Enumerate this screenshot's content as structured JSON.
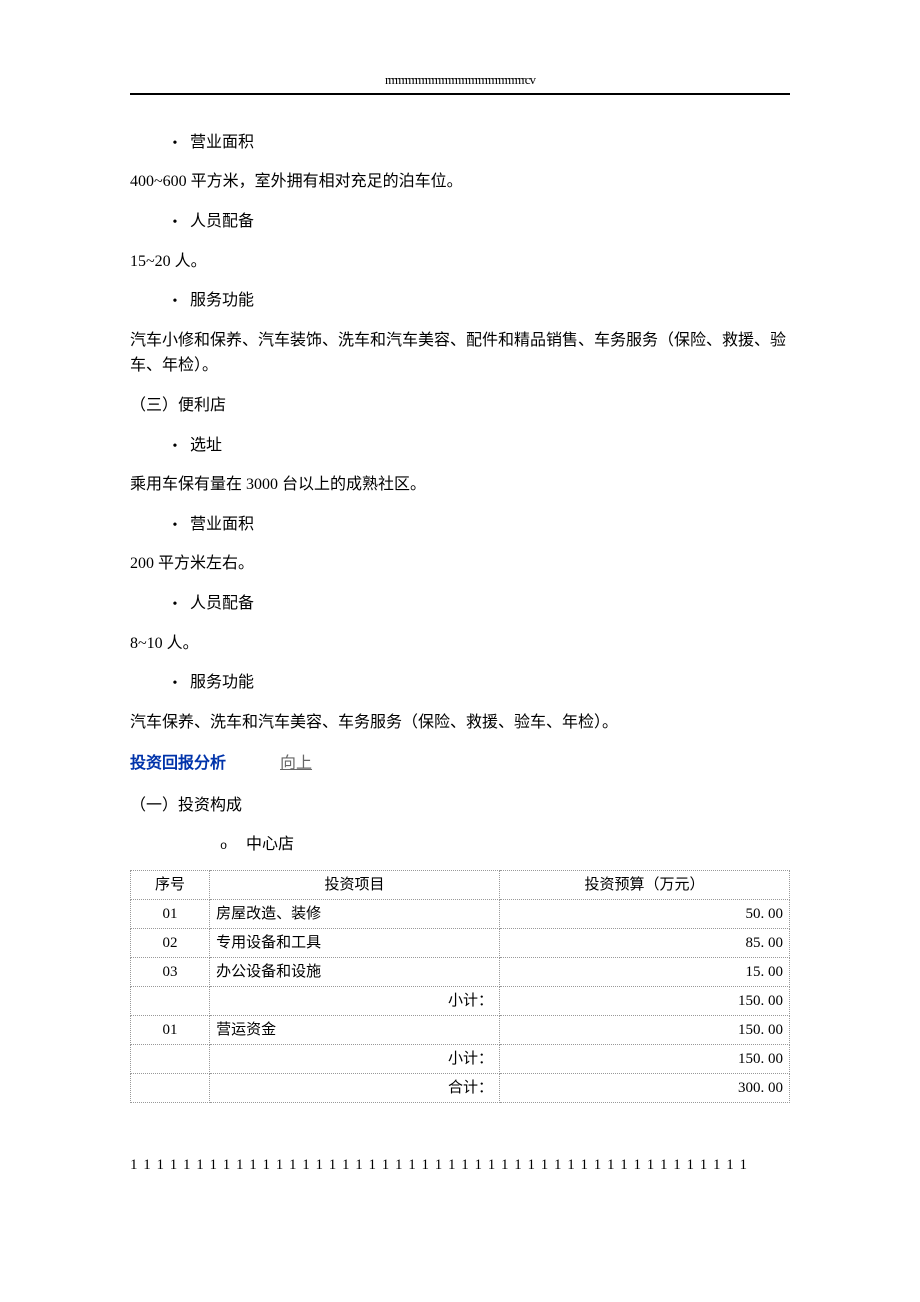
{
  "header": "rrrrrrrrrrrrrrrrrrrrrrrrrrrrrrrrrrrrrrrrrrcv",
  "section1": {
    "area_label": "营业面积",
    "area_text": "400~600 平方米，室外拥有相对充足的泊车位。",
    "staff_label": "人员配备",
    "staff_text": "15~20 人。",
    "service_label": "服务功能",
    "service_text": "汽车小修和保养、汽车装饰、洗车和汽车美容、配件和精品销售、车务服务（保险、救援、验车、年检）。"
  },
  "section2": {
    "title": "（三）便利店",
    "site_label": "选址",
    "site_text": "乘用车保有量在 3000 台以上的成熟社区。",
    "area_label": "营业面积",
    "area_text": "200 平方米左右。",
    "staff_label": "人员配备",
    "staff_text": "8~10 人。",
    "service_label": "服务功能",
    "service_text": "汽车保养、洗车和汽车美容、车务服务（保险、救援、验车、年检）。"
  },
  "analysis": {
    "title": "投资回报分析",
    "up_link": "向上",
    "sub1": "（一）投资构成",
    "store_label": "中心店"
  },
  "table": {
    "headers": {
      "seq": "序号",
      "item": "投资项目",
      "budget": "投资预算（万元）"
    },
    "rows": [
      {
        "seq": "01",
        "item": "房屋改造、装修",
        "budget": "50. 00"
      },
      {
        "seq": "02",
        "item": "专用设备和工具",
        "budget": "85. 00"
      },
      {
        "seq": "03",
        "item": "办公设备和设施",
        "budget": "15. 00"
      }
    ],
    "subtotal1_label": "小计：",
    "subtotal1_value": "150. 00",
    "row4": {
      "seq": "01",
      "item": "营运资金",
      "budget": "150. 00"
    },
    "subtotal2_label": "小计：",
    "subtotal2_value": "150. 00",
    "total_label": "合计：",
    "total_value": "300. 00"
  },
  "footer": "1 1 1 1 1 1 1 1 1 1 1 1 1 1 1 1 1 1 1 1 1 1 1 1 1 1 1 1 1 1 1 1 1 1 1 1 1 1 1 1 1 1 1 1 1 1 1"
}
